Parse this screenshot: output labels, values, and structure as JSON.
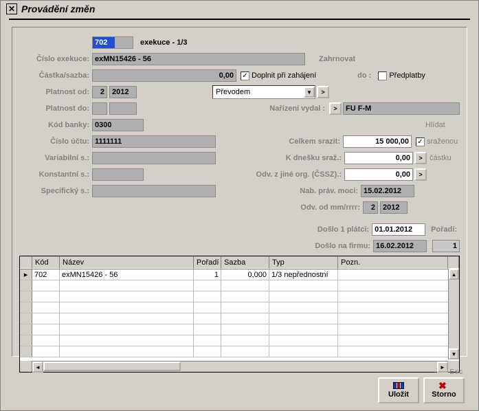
{
  "window": {
    "title": "Provádění změn"
  },
  "header": {
    "code": "702",
    "desc": "exekuce - 1/3"
  },
  "fields": {
    "cislo_exekuce_label": "Číslo exekuce:",
    "cislo_exekuce": "exMN15426 - 56",
    "castka_label": "Částka/sazba:",
    "castka": "0,00",
    "doplnit_label": "Doplnit při zahájení",
    "zahrnovat": "Zahrnovat",
    "do": "do :",
    "predplatby": "Předplatby",
    "platnost_od_label": "Platnost od:",
    "platnost_od_m": "2",
    "platnost_od_r": "2012",
    "platnost_do_label": "Platnost do:",
    "prevod": "Převodem",
    "narizeni_label": "Nařízení vydal :",
    "narizeni": "FU F-M",
    "kod_banky_label": "Kód banky:",
    "kod_banky": "0300",
    "cislo_uctu_label": "Číslo účtu:",
    "cislo_uctu": "1111111",
    "variabilni_label": "Variabilní s.:",
    "konstantni_label": "Konstantní s.:",
    "specificky_label": "Specifický s.:",
    "celkem_label": "Celkem srazit:",
    "celkem": "15 000,00",
    "kdnesku_label": "K dnešku sraž.:",
    "kdnesku": "0,00",
    "odvjine_label": "Odv. z jiné org. (ČSSZ).:",
    "odvjine": "0,00",
    "nabprav_label": "Nab. práv. moci:",
    "nabprav": "15.02.2012",
    "odvod_label": "Odv. od mm/rrrr:",
    "odvod_m": "2",
    "odvod_r": "2012",
    "doslo1_label": "Došlo 1 plátci:",
    "doslo1": "01.01.2012",
    "poradi_label": "Pořadí:",
    "poradi": "1",
    "doslofirmu_label": "Došlo na firmu:",
    "doslofirmu": "16.02.2012",
    "hlidat": "Hlídat",
    "srazenou": "sraženou",
    "castku": "částku"
  },
  "grid": {
    "headers": {
      "kod": "Kód",
      "nazev": "Název",
      "poradi": "Pořadí",
      "sazba": "Sazba",
      "typ": "Typ",
      "pozn": "Pozn."
    },
    "row1": {
      "kod": "702",
      "nazev": "exMN15426 - 56",
      "poradi": "1",
      "sazba": "0,000",
      "typ": "1/3 nepřednostní"
    }
  },
  "buttons": {
    "save": "Uložit",
    "cancel": "Storno",
    "esc": "Esc"
  }
}
